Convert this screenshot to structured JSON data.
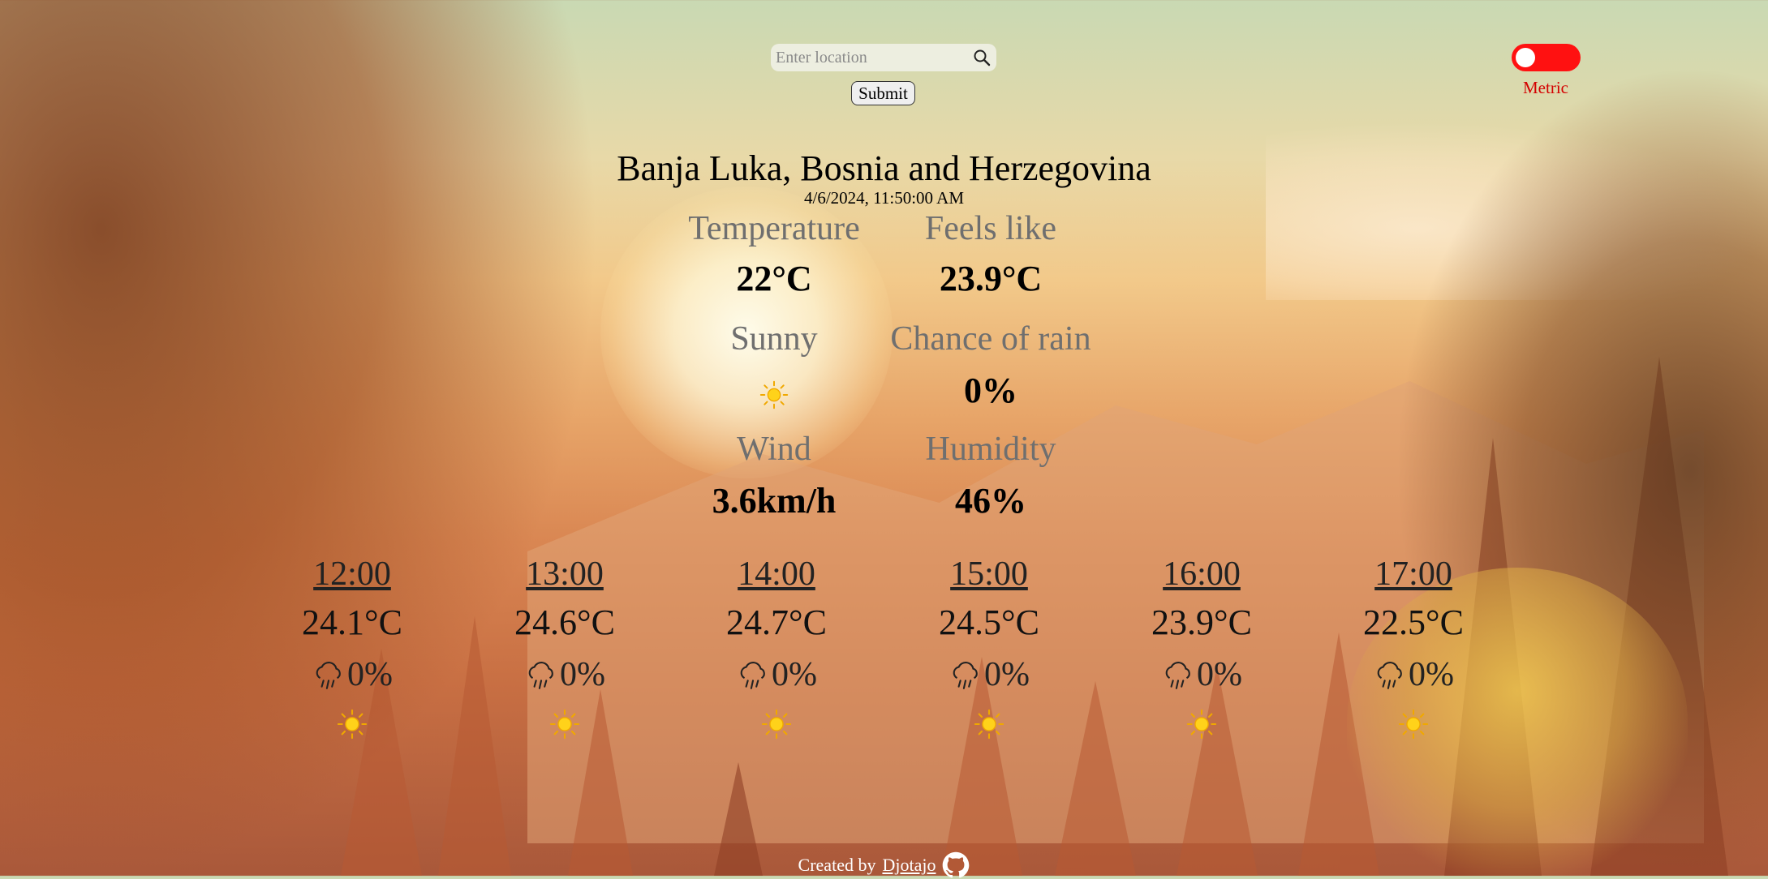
{
  "search": {
    "placeholder": "Enter location",
    "value": ""
  },
  "submit_label": "Submit",
  "units": {
    "label": "Metric",
    "toggle_color": "#ff1111"
  },
  "location": "Banja Luka, Bosnia and Herzegovina",
  "datetime": "4/6/2024, 11:50:00 AM",
  "current": {
    "temperature_label": "Temperature",
    "temperature_value": "22°C",
    "feels_like_label": "Feels like",
    "feels_like_value": "23.9°C",
    "condition_label": "Sunny",
    "condition_icon": "sun-icon",
    "rain_label": "Chance of rain",
    "rain_value": "0%",
    "wind_label": "Wind",
    "wind_value": "3.6km/h",
    "humidity_label": "Humidity",
    "humidity_value": "46%"
  },
  "hourly": [
    {
      "time": "12:00",
      "temp": "24.1°C",
      "rain": "0%",
      "icon": "sun-icon"
    },
    {
      "time": "13:00",
      "temp": "24.6°C",
      "rain": "0%",
      "icon": "sun-icon"
    },
    {
      "time": "14:00",
      "temp": "24.7°C",
      "rain": "0%",
      "icon": "sun-icon"
    },
    {
      "time": "15:00",
      "temp": "24.5°C",
      "rain": "0%",
      "icon": "sun-icon"
    },
    {
      "time": "16:00",
      "temp": "23.9°C",
      "rain": "0%",
      "icon": "sun-icon"
    },
    {
      "time": "17:00",
      "temp": "22.5°C",
      "rain": "0%",
      "icon": "sun-icon"
    }
  ],
  "footer": {
    "text": "Created by",
    "author": "Djotajo",
    "icon": "github-icon"
  }
}
